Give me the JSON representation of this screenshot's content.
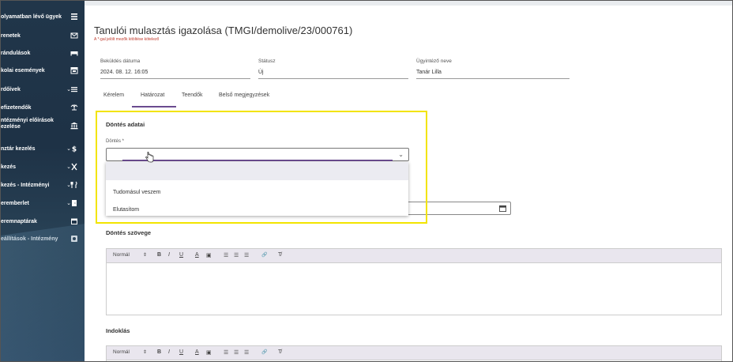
{
  "sidebar": {
    "items": [
      {
        "label": "olyamatban lévő ügyek",
        "icon": "list-icon",
        "chevron": ""
      },
      {
        "label": "renetek",
        "icon": "mail-icon",
        "chevron": ""
      },
      {
        "label": "rándulások",
        "icon": "bed-icon",
        "chevron": ""
      },
      {
        "label": "kolai események",
        "icon": "calendar-icon",
        "chevron": ""
      },
      {
        "label": "rdőívek",
        "icon": "menu-icon",
        "chevron": "⌄"
      },
      {
        "label": "efizetendők",
        "icon": "scale-icon",
        "chevron": ""
      },
      {
        "label": "ntézményi előírások\nezelése",
        "icon": "bank-icon",
        "chevron": ""
      },
      {
        "label": "nztár kezelés",
        "icon": "dollar-icon",
        "chevron": "⌄"
      },
      {
        "label": "kezés",
        "icon": "cutlery-icon",
        "chevron": "⌄"
      },
      {
        "label": "kezés - Intézményi",
        "icon": "fork-knife-icon",
        "chevron": "⌄"
      },
      {
        "label": "eremberlet",
        "icon": "door-icon",
        "chevron": "⌄"
      },
      {
        "label": "eremnaptárak",
        "icon": "calendar2-icon",
        "chevron": ""
      },
      {
        "label": "eállítások - Intézmény",
        "icon": "gear-icon",
        "chevron": ""
      }
    ]
  },
  "page": {
    "title": "Tanulói mulasztás igazolása (TMGI/demolive/23/000761)",
    "required_note": "A *-gal jelölt mezők kitöltése kötelező"
  },
  "fields": {
    "submit_date_label": "Beküldés dátuma",
    "submit_date_value": "2024. 08. 12. 16:05",
    "status_label": "Státusz",
    "status_value": "Új",
    "officer_label": "Ügyintéző neve",
    "officer_value": "Tanár Lilla"
  },
  "tabs": [
    "Kérelem",
    "Határozat",
    "Teendők",
    "Belső megjegyzések"
  ],
  "active_tab": "Határozat",
  "decision": {
    "section_title": "Döntés adatai",
    "select_label": "Döntés *",
    "select_value": "",
    "options": [
      "Tudomásul veszem",
      "Elutasítom"
    ]
  },
  "decision_text": {
    "section_title": "Döntés szövege"
  },
  "justification": {
    "section_title": "Indoklás"
  },
  "editor_toolbar": {
    "format": "Normál",
    "arrows": "⇕",
    "bold": "B",
    "italic": "I",
    "underline": "U",
    "color": "A",
    "highlight": "▣",
    "ordered_list": "☰",
    "bullet_list": "☰",
    "align": "☰",
    "link": "🔗",
    "clear": "T̸"
  },
  "colors": {
    "accent": "#6a4b8f",
    "highlight_box": "#f2e400",
    "sidebar_bg": "#21364a"
  }
}
